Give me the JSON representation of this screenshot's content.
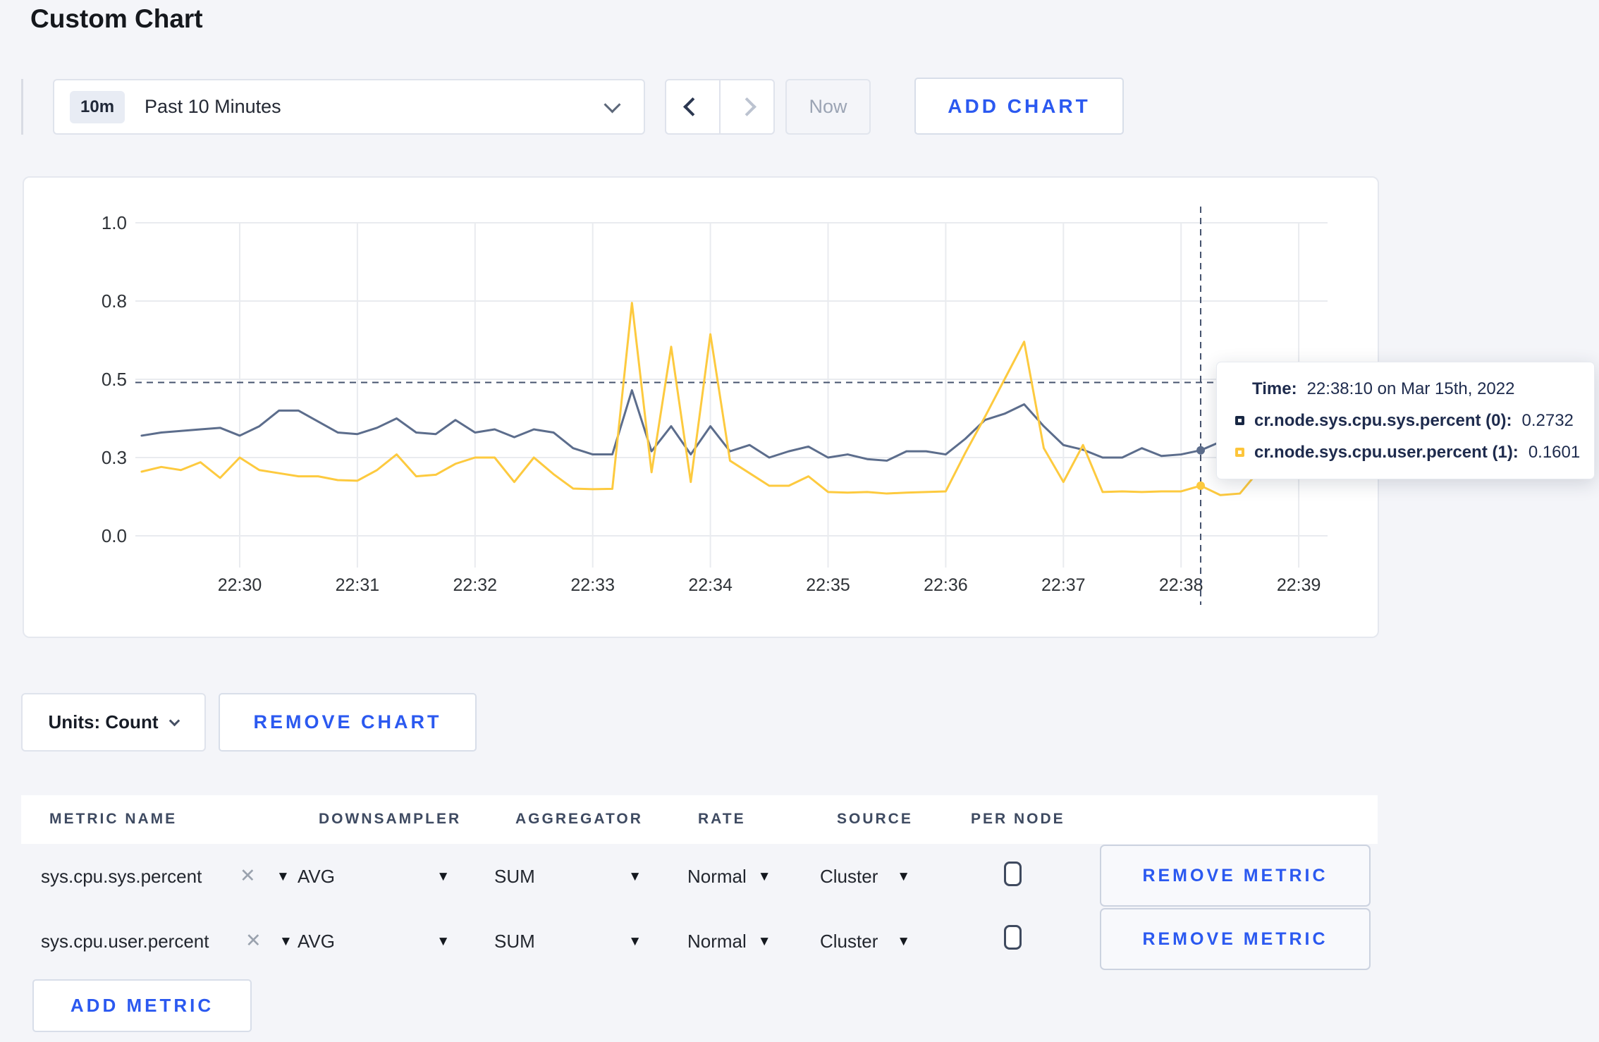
{
  "page": {
    "title": "Custom Chart",
    "accent_blue": "#2b59f0",
    "background": "#f4f5f9"
  },
  "toolbar": {
    "time_badge": "10m",
    "time_label": "Past 10 Minutes",
    "now_label": "Now",
    "add_chart_label": "ADD CHART"
  },
  "chart_data": {
    "type": "line",
    "title": "",
    "xlabel": "",
    "ylabel": "",
    "ylim": [
      0.0,
      1.0
    ],
    "grid": true,
    "x_ticks": [
      "22:30",
      "22:31",
      "22:32",
      "22:33",
      "22:34",
      "22:35",
      "22:36",
      "22:37",
      "22:38",
      "22:39"
    ],
    "y_ticks": [
      "1.0",
      "0.8",
      "0.5",
      "0.3",
      "0.0"
    ],
    "y_tick_values": [
      1.0,
      0.75,
      0.5,
      0.25,
      0.0
    ],
    "x_start": "22:29:10",
    "x_step_seconds": 10,
    "hover_index": 54,
    "crosshair": {
      "x_time": "22:38:10",
      "y_value": 0.49
    },
    "series": [
      {
        "name": "cr.node.sys.cpu.sys.percent (0)",
        "color": "#5c6d8c",
        "values": [
          0.32,
          0.33,
          0.335,
          0.34,
          0.345,
          0.32,
          0.35,
          0.4,
          0.4,
          0.365,
          0.33,
          0.325,
          0.345,
          0.375,
          0.33,
          0.325,
          0.37,
          0.33,
          0.34,
          0.315,
          0.34,
          0.33,
          0.28,
          0.26,
          0.26,
          0.465,
          0.27,
          0.35,
          0.26,
          0.35,
          0.27,
          0.29,
          0.25,
          0.27,
          0.285,
          0.25,
          0.26,
          0.245,
          0.24,
          0.27,
          0.27,
          0.26,
          0.31,
          0.37,
          0.39,
          0.42,
          0.35,
          0.29,
          0.275,
          0.25,
          0.25,
          0.28,
          0.255,
          0.26,
          0.2732,
          0.3,
          0.295,
          0.3,
          0.3,
          0.31,
          0.3
        ]
      },
      {
        "name": "cr.node.sys.cpu.user.percent (1)",
        "color": "#fdca3f",
        "values": [
          0.205,
          0.22,
          0.21,
          0.235,
          0.185,
          0.25,
          0.21,
          0.2,
          0.19,
          0.19,
          0.178,
          0.176,
          0.21,
          0.26,
          0.19,
          0.195,
          0.23,
          0.25,
          0.25,
          0.172,
          0.25,
          0.197,
          0.151,
          0.149,
          0.15,
          0.744,
          0.203,
          0.604,
          0.172,
          0.644,
          0.24,
          0.2,
          0.16,
          0.16,
          0.19,
          0.14,
          0.138,
          0.14,
          0.135,
          0.138,
          0.14,
          0.142,
          0.265,
          0.38,
          0.5,
          0.62,
          0.28,
          0.172,
          0.29,
          0.14,
          0.142,
          0.14,
          0.142,
          0.142,
          0.1601,
          0.13,
          0.135,
          0.21,
          0.19,
          0.265,
          0.245
        ]
      }
    ]
  },
  "tooltip": {
    "time_label": "Time:",
    "time_value": "22:38:10 on Mar 15th, 2022",
    "rows": [
      {
        "label": "cr.node.sys.cpu.sys.percent (0):",
        "value": "0.2732",
        "color": "#182743"
      },
      {
        "label": "cr.node.sys.cpu.user.percent (1):",
        "value": "0.1601",
        "color": "#fdc53a"
      }
    ]
  },
  "chart_controls": {
    "units_label": "Units: Count",
    "remove_chart_label": "REMOVE CHART"
  },
  "metrics_table": {
    "headers": [
      "METRIC NAME",
      "DOWNSAMPLER",
      "AGGREGATOR",
      "RATE",
      "SOURCE",
      "PER NODE"
    ],
    "rows": [
      {
        "metric_name": "sys.cpu.sys.percent",
        "downsampler": "AVG",
        "aggregator": "SUM",
        "rate": "Normal",
        "source": "Cluster",
        "per_node_checked": false,
        "remove_label": "REMOVE METRIC"
      },
      {
        "metric_name": "sys.cpu.user.percent",
        "downsampler": "AVG",
        "aggregator": "SUM",
        "rate": "Normal",
        "source": "Cluster",
        "per_node_checked": false,
        "remove_label": "REMOVE METRIC"
      }
    ],
    "add_metric_label": "ADD METRIC"
  }
}
